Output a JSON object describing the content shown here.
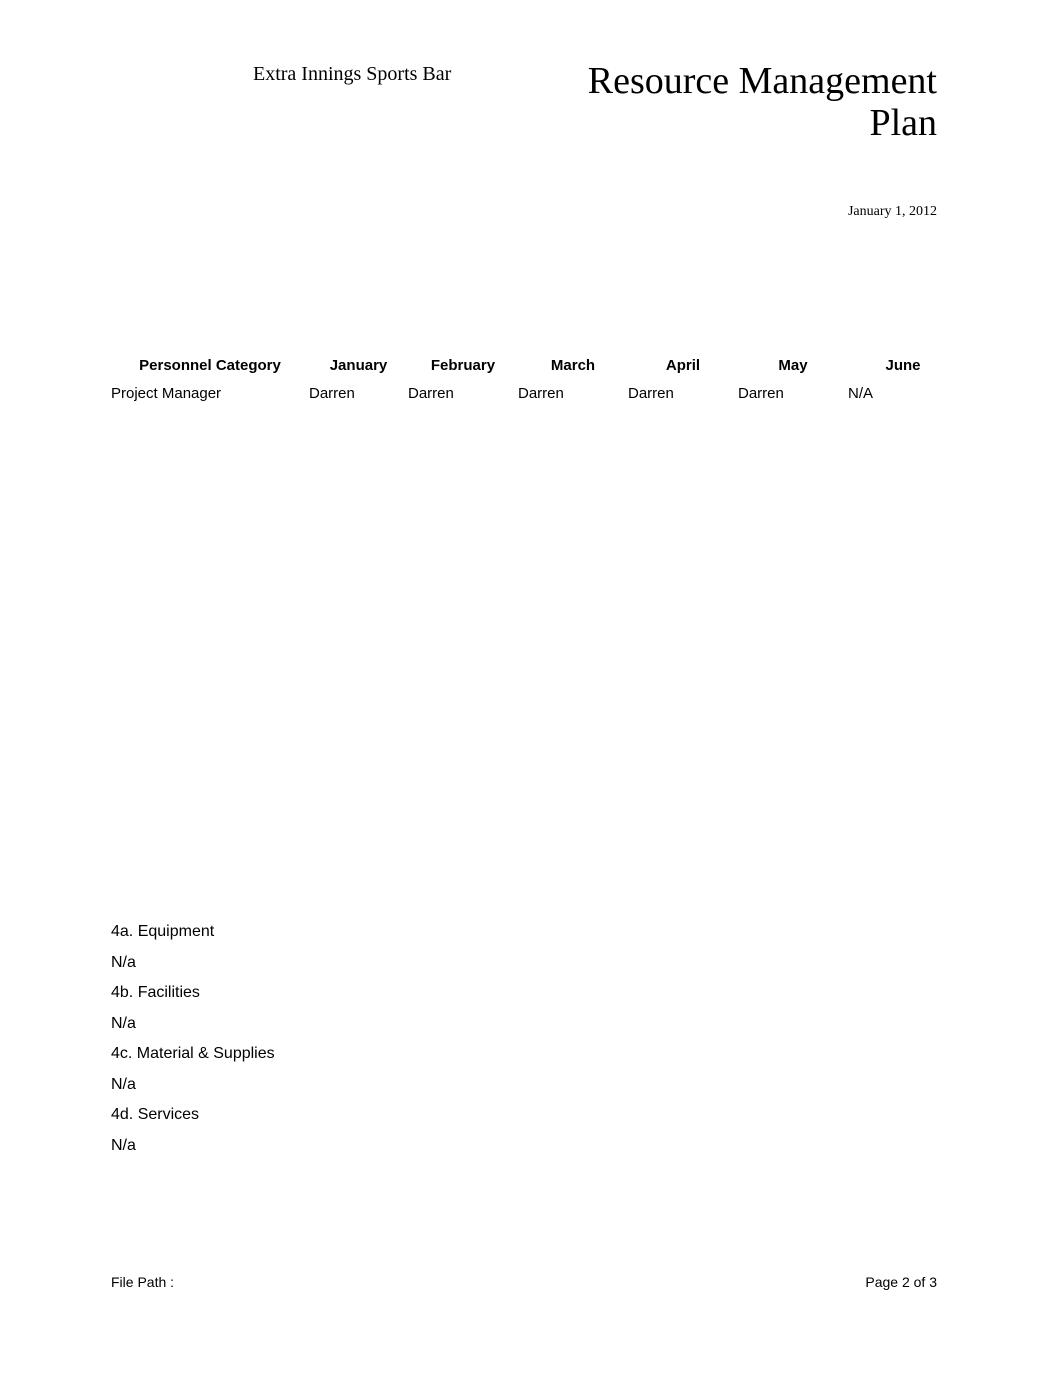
{
  "header": {
    "organization": "Extra Innings Sports Bar",
    "title": "Resource Management Plan",
    "date": "January 1, 2012"
  },
  "resource_table": {
    "columns": [
      "Personnel Category",
      "January",
      "February",
      "March",
      "April",
      "May",
      "June"
    ],
    "rows": [
      {
        "category": "Project Manager",
        "january": "Darren",
        "february": "Darren",
        "march": "Darren",
        "april": "Darren",
        "may": "Darren",
        "june": "N/A"
      }
    ]
  },
  "sections": [
    {
      "heading": "4a. Equipment",
      "value": "N/a"
    },
    {
      "heading": "4b. Facilities",
      "value": "N/a"
    },
    {
      "heading": "4c. Material & Supplies",
      "value": "N/a"
    },
    {
      "heading": "4d. Services",
      "value": "N/a"
    }
  ],
  "footer": {
    "file_path_label": "File Path :",
    "page_number": "Page 2 of 3"
  }
}
